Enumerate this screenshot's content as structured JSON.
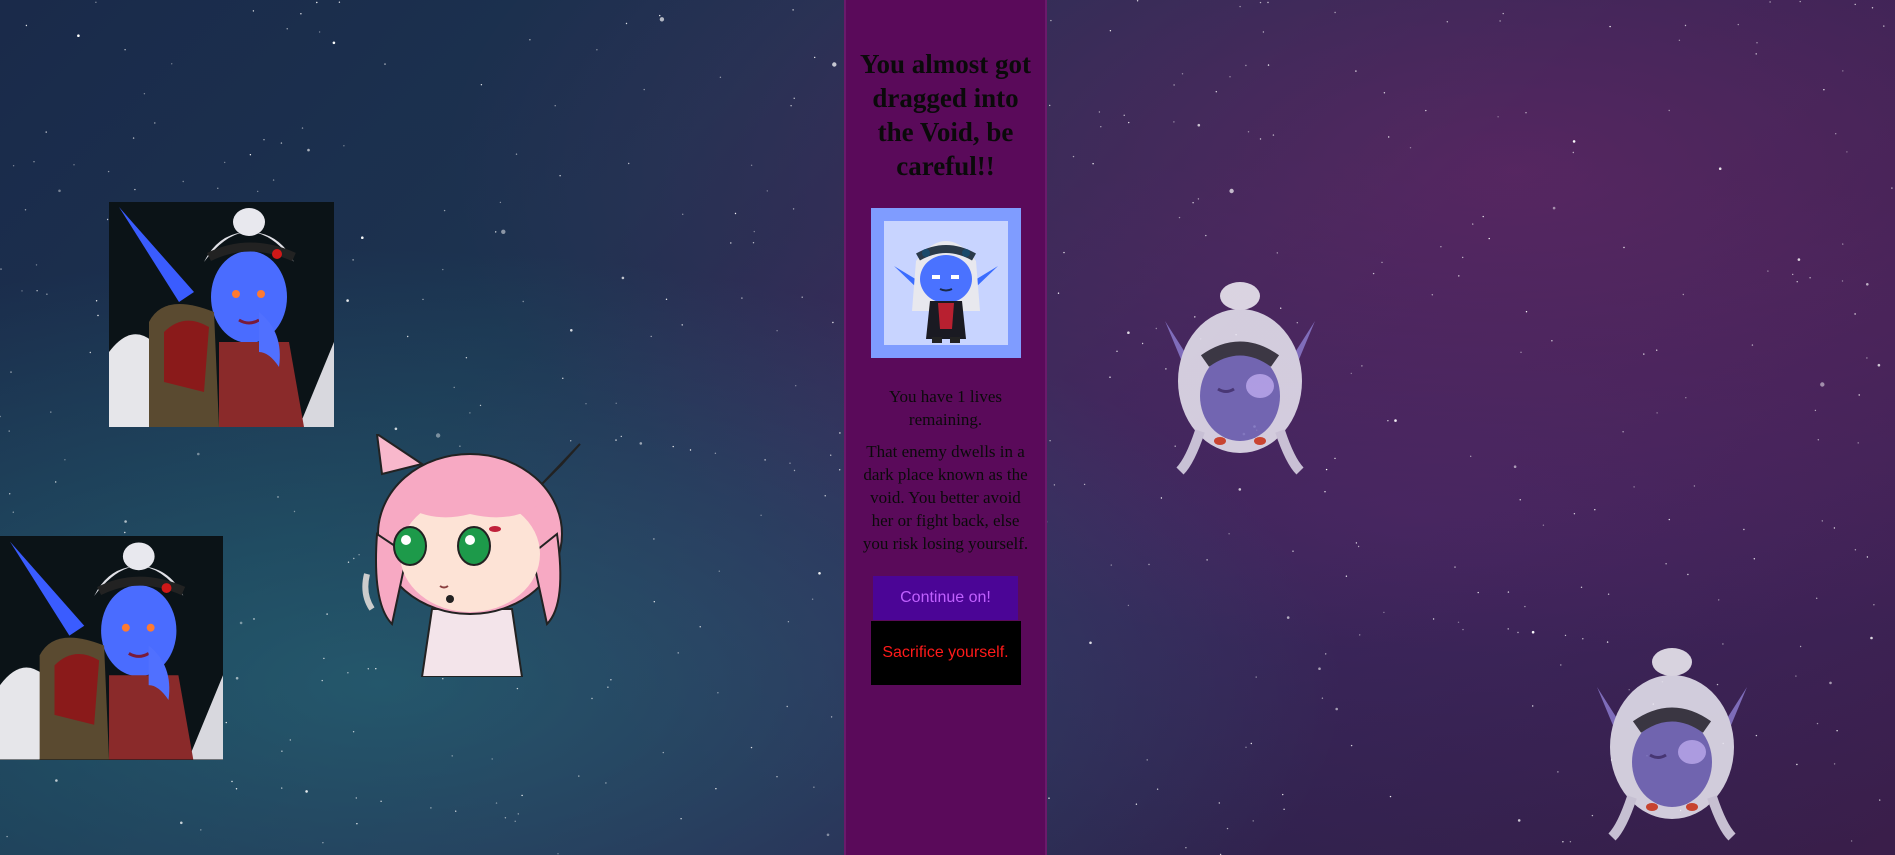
{
  "dialog": {
    "title": "You almost got dragged into the Void, be careful!!",
    "lives_text": "You have 1 lives remaining.",
    "story_text": "That enemy dwells in a dark place known as the void. You better avoid her or fight back, else you risk losing yourself.",
    "continue_label": "Continue on!",
    "sacrifice_label": "Sacrifice yourself."
  },
  "colors": {
    "panel_bg": "#5a0a5a",
    "avatar_frame": "#7f9cff",
    "continue_bg": "#4b0596",
    "continue_text": "#c060ff",
    "sacrifice_bg": "#000000",
    "sacrifice_text": "#ff1a1a"
  },
  "sprites": {
    "void_elf_portrait": "void-elf-portrait",
    "cat_girl": "pink-cat-girl-chibi",
    "ghost_elf": "faded-void-elf-chibi",
    "player_avatar": "void-elf-chibi-avatar"
  }
}
